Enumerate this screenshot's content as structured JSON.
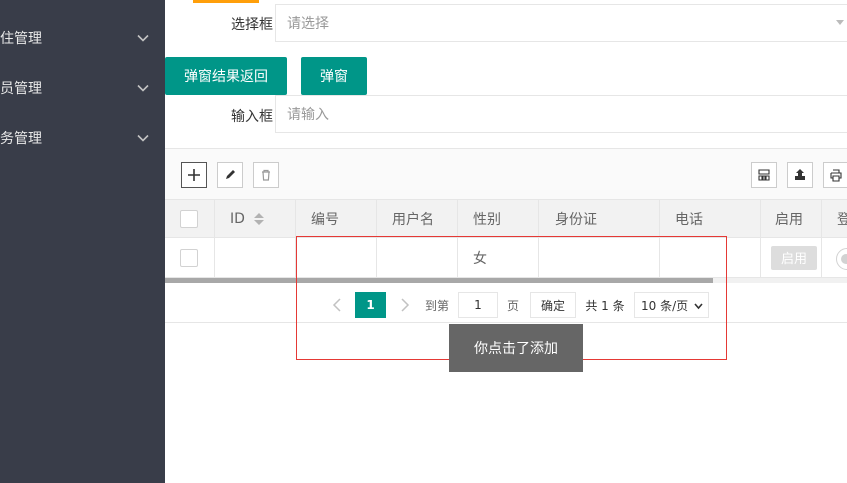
{
  "sidebar": {
    "items": [
      {
        "label": "住管理"
      },
      {
        "label": "员管理"
      },
      {
        "label": "务管理"
      }
    ]
  },
  "form": {
    "select_label": "选择框",
    "select_placeholder": "请选择",
    "btn_return": "弹窗结果返回",
    "btn_popup": "弹窗",
    "input_label": "输入框",
    "input_placeholder": "请输入"
  },
  "table": {
    "headers": [
      "ID",
      "编号",
      "用户名",
      "性别",
      "身份证",
      "电话",
      "启用",
      "登"
    ],
    "rows": [
      {
        "id": "",
        "code": "",
        "username": "",
        "gender": "女",
        "idcard": "",
        "phone": "",
        "enable": "启用"
      }
    ]
  },
  "pager": {
    "current": "1",
    "goto_label": "到第",
    "goto_value": "1",
    "page_unit": "页",
    "confirm": "确定",
    "total": "共 1 条",
    "per_page": "10 条/页"
  },
  "toast": {
    "message": "你点击了添加"
  },
  "colors": {
    "sidebar_bg": "#393d49",
    "primary": "#009688",
    "accent": "#ff9f0a",
    "highlight_border": "#e53935"
  }
}
